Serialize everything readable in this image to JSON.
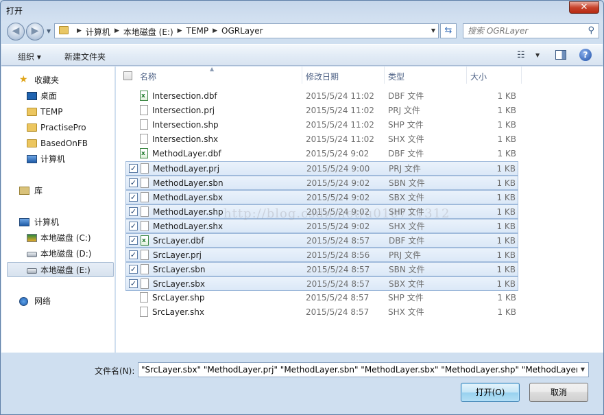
{
  "window": {
    "title": "打开",
    "close_label": "✕"
  },
  "address": {
    "crumbs": [
      "计算机",
      "本地磁盘 (E:)",
      "TEMP",
      "OGRLayer"
    ]
  },
  "search": {
    "placeholder": "搜索 OGRLayer"
  },
  "toolbar": {
    "organize_label": "组织 ▾",
    "new_folder_label": "新建文件夹",
    "help_label": "?"
  },
  "navpane": {
    "items": [
      {
        "label": "收藏夹",
        "icon": "star-icon"
      },
      {
        "label": "桌面",
        "icon": "desktop-icon"
      },
      {
        "label": "TEMP",
        "icon": "folder-icon"
      },
      {
        "label": "PractisePro",
        "icon": "folder-icon"
      },
      {
        "label": "BasedOnFB",
        "icon": "folder-icon"
      },
      {
        "label": "计算机",
        "icon": "computer-icon"
      },
      {
        "label": "库",
        "icon": "library-icon"
      },
      {
        "label": "计算机",
        "icon": "computer-icon"
      },
      {
        "label": "本地磁盘 (C:)",
        "icon": "system-drive-icon"
      },
      {
        "label": "本地磁盘 (D:)",
        "icon": "drive-icon"
      },
      {
        "label": "本地磁盘 (E:)",
        "icon": "drive-icon",
        "selected": true
      },
      {
        "label": "网络",
        "icon": "network-icon"
      }
    ]
  },
  "columns": {
    "name": "名称",
    "date": "修改日期",
    "type": "类型",
    "size": "大小"
  },
  "files": [
    {
      "name": "Intersection.dbf",
      "date": "2015/5/24 11:02",
      "type": "DBF 文件",
      "size": "1 KB",
      "checked": false,
      "kind": "dbf"
    },
    {
      "name": "Intersection.prj",
      "date": "2015/5/24 11:02",
      "type": "PRJ 文件",
      "size": "1 KB",
      "checked": false,
      "kind": "doc"
    },
    {
      "name": "Intersection.shp",
      "date": "2015/5/24 11:02",
      "type": "SHP 文件",
      "size": "1 KB",
      "checked": false,
      "kind": "doc"
    },
    {
      "name": "Intersection.shx",
      "date": "2015/5/24 11:02",
      "type": "SHX 文件",
      "size": "1 KB",
      "checked": false,
      "kind": "doc"
    },
    {
      "name": "MethodLayer.dbf",
      "date": "2015/5/24 9:02",
      "type": "DBF 文件",
      "size": "1 KB",
      "checked": false,
      "kind": "dbf"
    },
    {
      "name": "MethodLayer.prj",
      "date": "2015/5/24 9:00",
      "type": "PRJ 文件",
      "size": "1 KB",
      "checked": true,
      "kind": "doc"
    },
    {
      "name": "MethodLayer.sbn",
      "date": "2015/5/24 9:02",
      "type": "SBN 文件",
      "size": "1 KB",
      "checked": true,
      "kind": "doc"
    },
    {
      "name": "MethodLayer.sbx",
      "date": "2015/5/24 9:02",
      "type": "SBX 文件",
      "size": "1 KB",
      "checked": true,
      "kind": "doc"
    },
    {
      "name": "MethodLayer.shp",
      "date": "2015/5/24 9:02",
      "type": "SHP 文件",
      "size": "1 KB",
      "checked": true,
      "kind": "doc"
    },
    {
      "name": "MethodLayer.shx",
      "date": "2015/5/24 9:02",
      "type": "SHX 文件",
      "size": "1 KB",
      "checked": true,
      "kind": "doc"
    },
    {
      "name": "SrcLayer.dbf",
      "date": "2015/5/24 8:57",
      "type": "DBF 文件",
      "size": "1 KB",
      "checked": true,
      "kind": "dbf"
    },
    {
      "name": "SrcLayer.prj",
      "date": "2015/5/24 8:56",
      "type": "PRJ 文件",
      "size": "1 KB",
      "checked": true,
      "kind": "doc"
    },
    {
      "name": "SrcLayer.sbn",
      "date": "2015/5/24 8:57",
      "type": "SBN 文件",
      "size": "1 KB",
      "checked": true,
      "kind": "doc"
    },
    {
      "name": "SrcLayer.sbx",
      "date": "2015/5/24 8:57",
      "type": "SBX 文件",
      "size": "1 KB",
      "checked": true,
      "kind": "doc"
    },
    {
      "name": "SrcLayer.shp",
      "date": "2015/5/24 8:57",
      "type": "SHP 文件",
      "size": "1 KB",
      "checked": false,
      "kind": "doc"
    },
    {
      "name": "SrcLayer.shx",
      "date": "2015/5/24 8:57",
      "type": "SHX 文件",
      "size": "1 KB",
      "checked": false,
      "kind": "doc"
    }
  ],
  "filename": {
    "label": "文件名(N):",
    "value": "\"SrcLayer.sbx\" \"MethodLayer.prj\" \"MethodLayer.sbn\" \"MethodLayer.sbx\" \"MethodLayer.shp\" \"MethodLayer.sh"
  },
  "buttons": {
    "open": "打开(O)",
    "cancel": "取消"
  },
  "watermark": "http://blog.csdn.net/u010771312"
}
